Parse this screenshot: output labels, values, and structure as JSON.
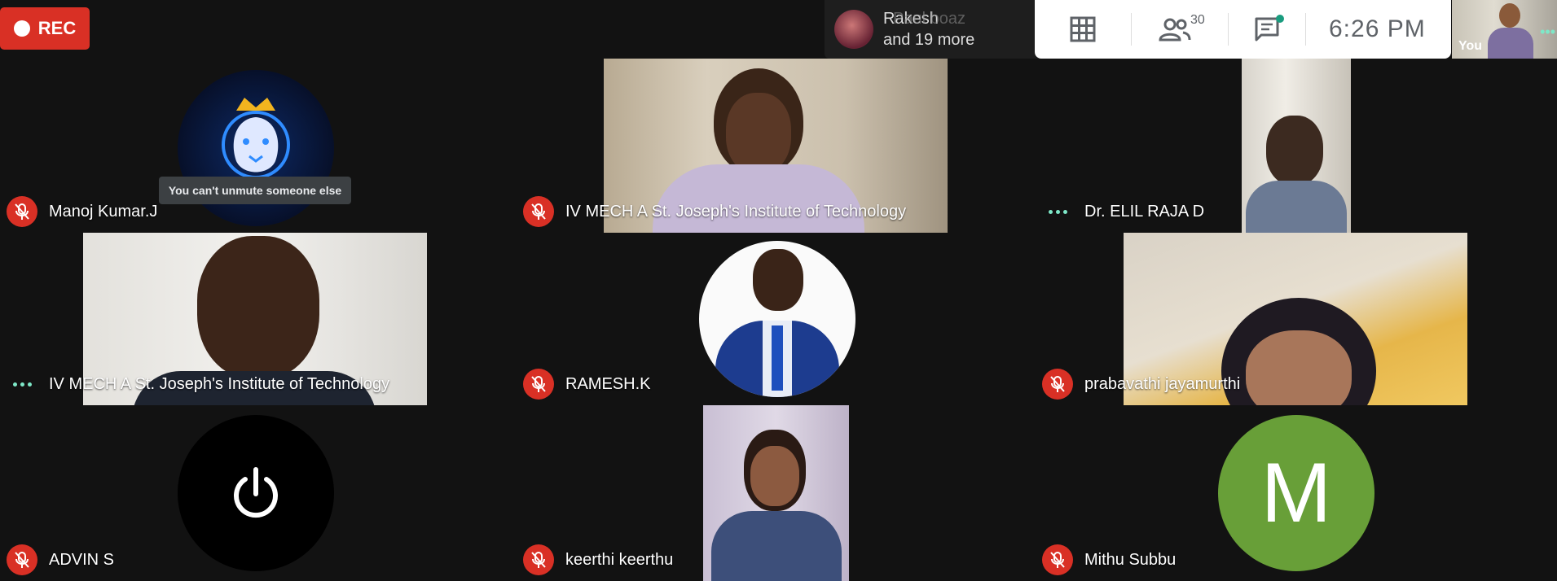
{
  "recording": {
    "label": "REC"
  },
  "toast": {
    "name": "Rakesh",
    "overlap_name": "Paul boaz",
    "more": "and 19 more"
  },
  "toolbar": {
    "participants_count": "30",
    "time": "6:26  PM",
    "icons": [
      "grid-layout-icon",
      "people-icon",
      "chat-icon"
    ]
  },
  "self_view": {
    "label": "You"
  },
  "tooltip": "You can't unmute someone else",
  "colors": {
    "muted_red": "#d93025",
    "speaking_dots": "#7ee8c8",
    "avatar_green": "#689f38",
    "background": "#121212"
  },
  "participants": [
    {
      "name": "Manoj Kumar.J",
      "status": "muted"
    },
    {
      "name": "IV MECH A St. Joseph's Institute of Technology",
      "status": "muted"
    },
    {
      "name": "Dr. ELIL RAJA D",
      "status": "speaking"
    },
    {
      "name": "IV MECH A St. Joseph's Institute of Technology",
      "status": "speaking"
    },
    {
      "name": "RAMESH.K",
      "status": "muted"
    },
    {
      "name": "prabavathi jayamurthi",
      "status": "muted"
    },
    {
      "name": "ADVIN S",
      "status": "muted"
    },
    {
      "name": "keerthi keerthu",
      "status": "muted"
    },
    {
      "name": "Mithu Subbu",
      "status": "muted",
      "avatar_letter": "M"
    }
  ]
}
